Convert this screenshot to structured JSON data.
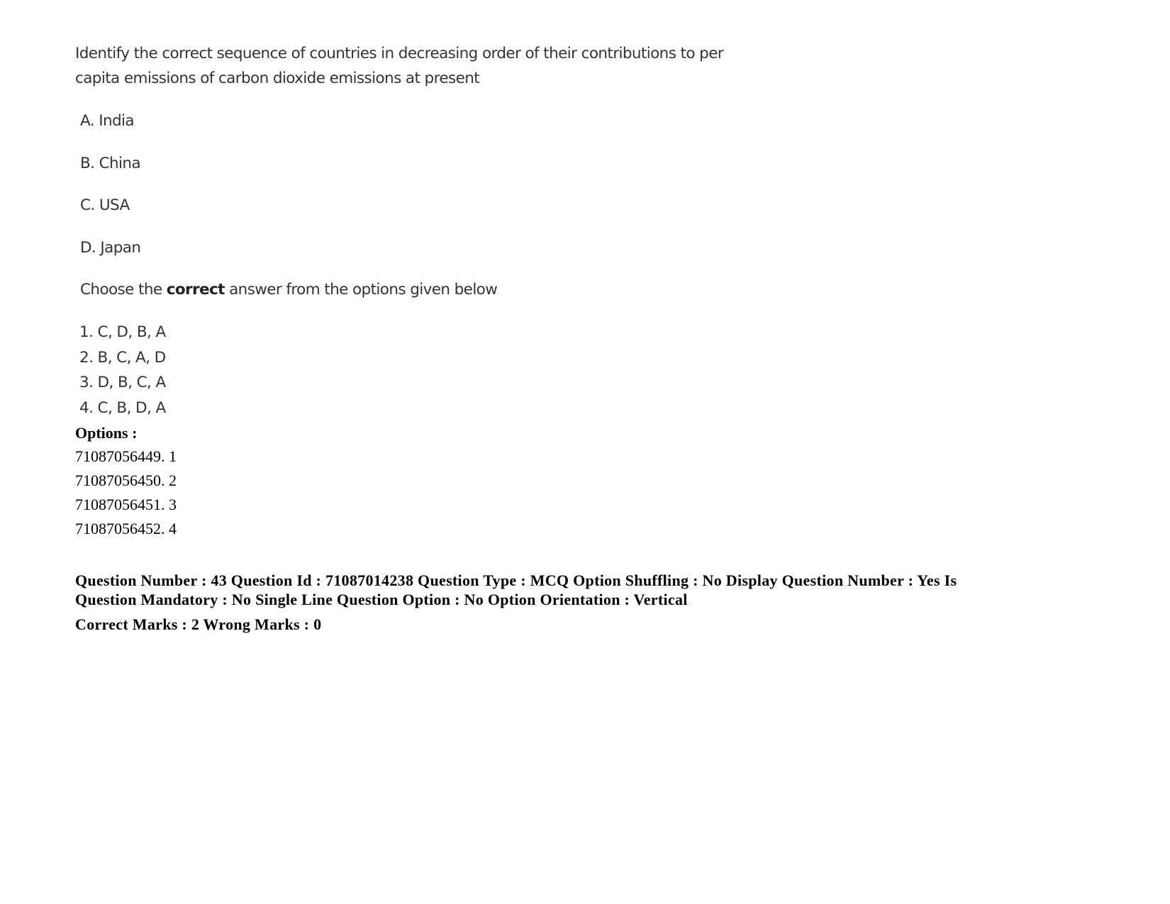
{
  "question": {
    "text_line1": "Identify the correct sequence of countries in decreasing order of their contributions to per",
    "text_line2": "capita emissions of carbon dioxide emissions at present",
    "statements": [
      {
        "label": "A. India"
      },
      {
        "label": "B. China"
      },
      {
        "label": "C. USA"
      },
      {
        "label": "D. Japan"
      }
    ],
    "instruction_prefix": "Choose the ",
    "instruction_emphasis": "correct",
    "instruction_suffix": " answer from the options given below",
    "choices": [
      {
        "label": "1. C, D, B, A"
      },
      {
        "label": "2. B, C, A, D"
      },
      {
        "label": "3. D, B, C, A"
      },
      {
        "label": "4. C, B, D, A"
      }
    ]
  },
  "options": {
    "heading": "Options :",
    "items": [
      {
        "label": "71087056449. 1"
      },
      {
        "label": "71087056450. 2"
      },
      {
        "label": "71087056451. 3"
      },
      {
        "label": "71087056452. 4"
      }
    ]
  },
  "next_question_meta": {
    "line1": "Question Number : 43 Question Id : 71087014238 Question Type : MCQ Option Shuffling : No Display Question Number : Yes Is",
    "line2": "Question Mandatory : No Single Line Question Option : No Option Orientation : Vertical",
    "marks": "Correct Marks : 2 Wrong Marks : 0"
  }
}
